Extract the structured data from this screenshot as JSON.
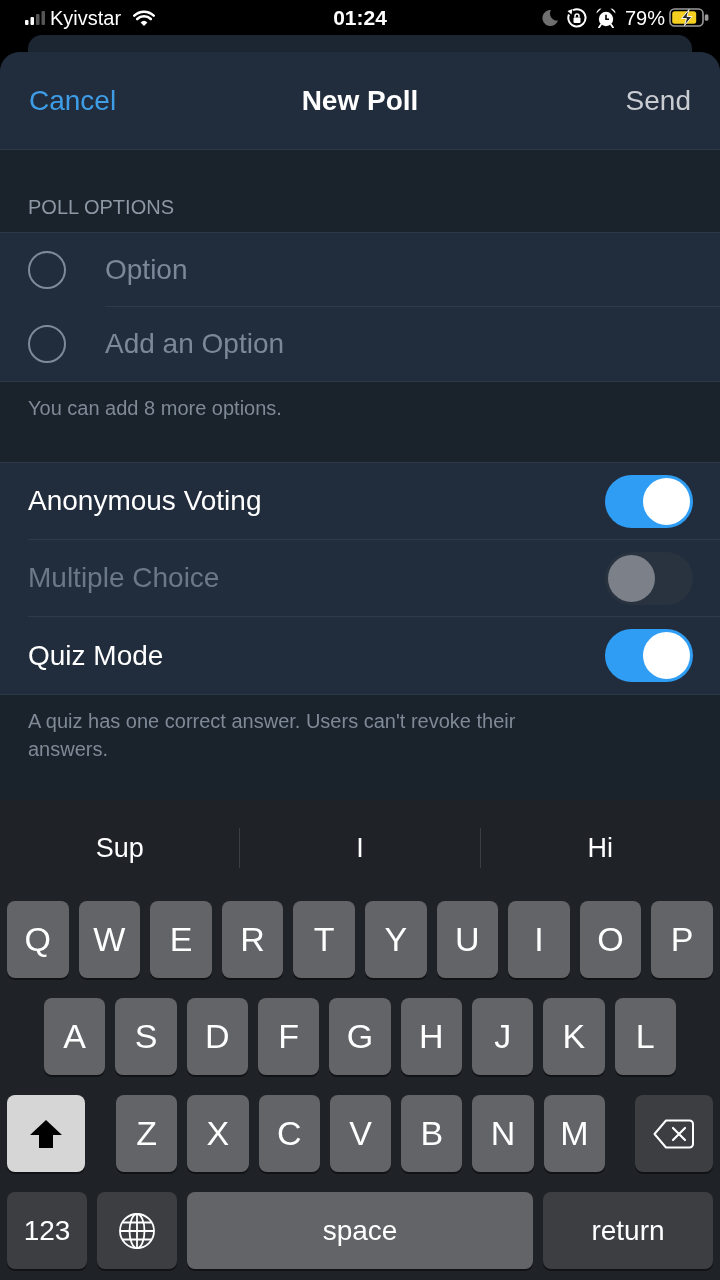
{
  "status_bar": {
    "carrier": "Kyivstar",
    "time": "01:24",
    "battery": "79%"
  },
  "header": {
    "cancel": "Cancel",
    "title": "New Poll",
    "send": {
      "label": "Send",
      "disabled": true
    }
  },
  "poll_options": {
    "title": "POLL OPTIONS",
    "options": [
      {
        "placeholder": "Option",
        "selected": false
      },
      {
        "placeholder": "Add an Option",
        "selected": false
      }
    ],
    "footer": "You can add 8 more options."
  },
  "settings": {
    "items": [
      {
        "label": "Anonymous Voting",
        "on": true,
        "disabled": false
      },
      {
        "label": "Multiple Choice",
        "on": false,
        "disabled": true
      },
      {
        "label": "Quiz Mode",
        "on": true,
        "disabled": false
      }
    ],
    "footer": "A quiz has one correct answer. Users can't revoke their answers."
  },
  "keyboard": {
    "suggestions": [
      "Sup",
      "I",
      "Hi"
    ],
    "rows": [
      {
        "keys": [
          {
            "kind": "letter",
            "label": "Q"
          },
          {
            "kind": "letter",
            "label": "W"
          },
          {
            "kind": "letter",
            "label": "E"
          },
          {
            "kind": "letter",
            "label": "R"
          },
          {
            "kind": "letter",
            "label": "T"
          },
          {
            "kind": "letter",
            "label": "Y"
          },
          {
            "kind": "letter",
            "label": "U"
          },
          {
            "kind": "letter",
            "label": "I"
          },
          {
            "kind": "letter",
            "label": "O"
          },
          {
            "kind": "letter",
            "label": "P"
          }
        ]
      },
      {
        "keys": [
          {
            "kind": "letter",
            "label": "A"
          },
          {
            "kind": "letter",
            "label": "S"
          },
          {
            "kind": "letter",
            "label": "D"
          },
          {
            "kind": "letter",
            "label": "F"
          },
          {
            "kind": "letter",
            "label": "G"
          },
          {
            "kind": "letter",
            "label": "H"
          },
          {
            "kind": "letter",
            "label": "J"
          },
          {
            "kind": "letter",
            "label": "K"
          },
          {
            "kind": "letter",
            "label": "L"
          }
        ]
      },
      {
        "keys": [
          {
            "kind": "shift",
            "on": true
          },
          {
            "kind": "letter",
            "label": "Z"
          },
          {
            "kind": "letter",
            "label": "X"
          },
          {
            "kind": "letter",
            "label": "C"
          },
          {
            "kind": "letter",
            "label": "V"
          },
          {
            "kind": "letter",
            "label": "B"
          },
          {
            "kind": "letter",
            "label": "N"
          },
          {
            "kind": "letter",
            "label": "M"
          },
          {
            "kind": "delete"
          }
        ]
      },
      {
        "keys": [
          {
            "kind": "numbers",
            "label": "123"
          },
          {
            "kind": "globe"
          },
          {
            "kind": "space",
            "label": "space"
          },
          {
            "kind": "return",
            "label": "return"
          }
        ]
      }
    ]
  }
}
